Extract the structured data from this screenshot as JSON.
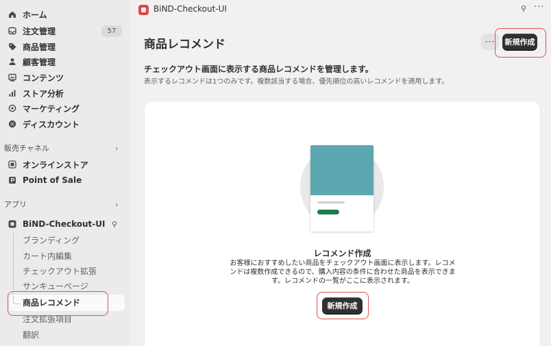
{
  "sidebar": {
    "items": [
      {
        "label": "ホーム",
        "icon": "home-icon"
      },
      {
        "label": "注文管理",
        "icon": "inbox-icon",
        "badge": "57"
      },
      {
        "label": "商品管理",
        "icon": "tag-icon"
      },
      {
        "label": "顧客管理",
        "icon": "person-icon"
      },
      {
        "label": "コンテンツ",
        "icon": "image-icon"
      },
      {
        "label": "ストア分析",
        "icon": "bar-chart-icon"
      },
      {
        "label": "マーケティング",
        "icon": "target-icon"
      },
      {
        "label": "ディスカウント",
        "icon": "discount-icon"
      }
    ],
    "sales_channels": {
      "heading": "販売チャネル",
      "items": [
        {
          "label": "オンラインストア",
          "icon": "storefront-icon"
        },
        {
          "label": "Point of Sale",
          "icon": "pos-icon"
        }
      ]
    },
    "apps": {
      "heading": "アプリ",
      "app": {
        "label": "BiND-Checkout-UI",
        "icon": "app-icon"
      },
      "sub_items": [
        "ブランディング",
        "カート内編集",
        "チェックアウト拡張",
        "サンキューページ",
        "商品レコメンド",
        "注文拡張項目",
        "翻訳"
      ]
    }
  },
  "topbar": {
    "app_title": "BiND-Checkout-UI"
  },
  "page": {
    "title": "商品レコメンド",
    "create_button": "新規作成",
    "description_title": "チェックアウト画面に表示する商品レコメンドを管理します。",
    "description_sub": "表示するレコメンドは1つのみです。複数該当する場合、優先順位の高いレコメンドを適用します。"
  },
  "empty_state": {
    "title": "レコメンド作成",
    "body": "お客様におすすめしたい商品をチェックアウト画面に表示します。レコメンドは複数作成できるので、購入内容の条件に合わせた商品を表示できます。レコメンドの一覧がここに表示されます。",
    "button": "新規作成"
  },
  "colors": {
    "accent": "#303030",
    "highlight": "#e25050",
    "illustration": "#5ca7b0",
    "illustration_pill": "#1f7a52"
  }
}
